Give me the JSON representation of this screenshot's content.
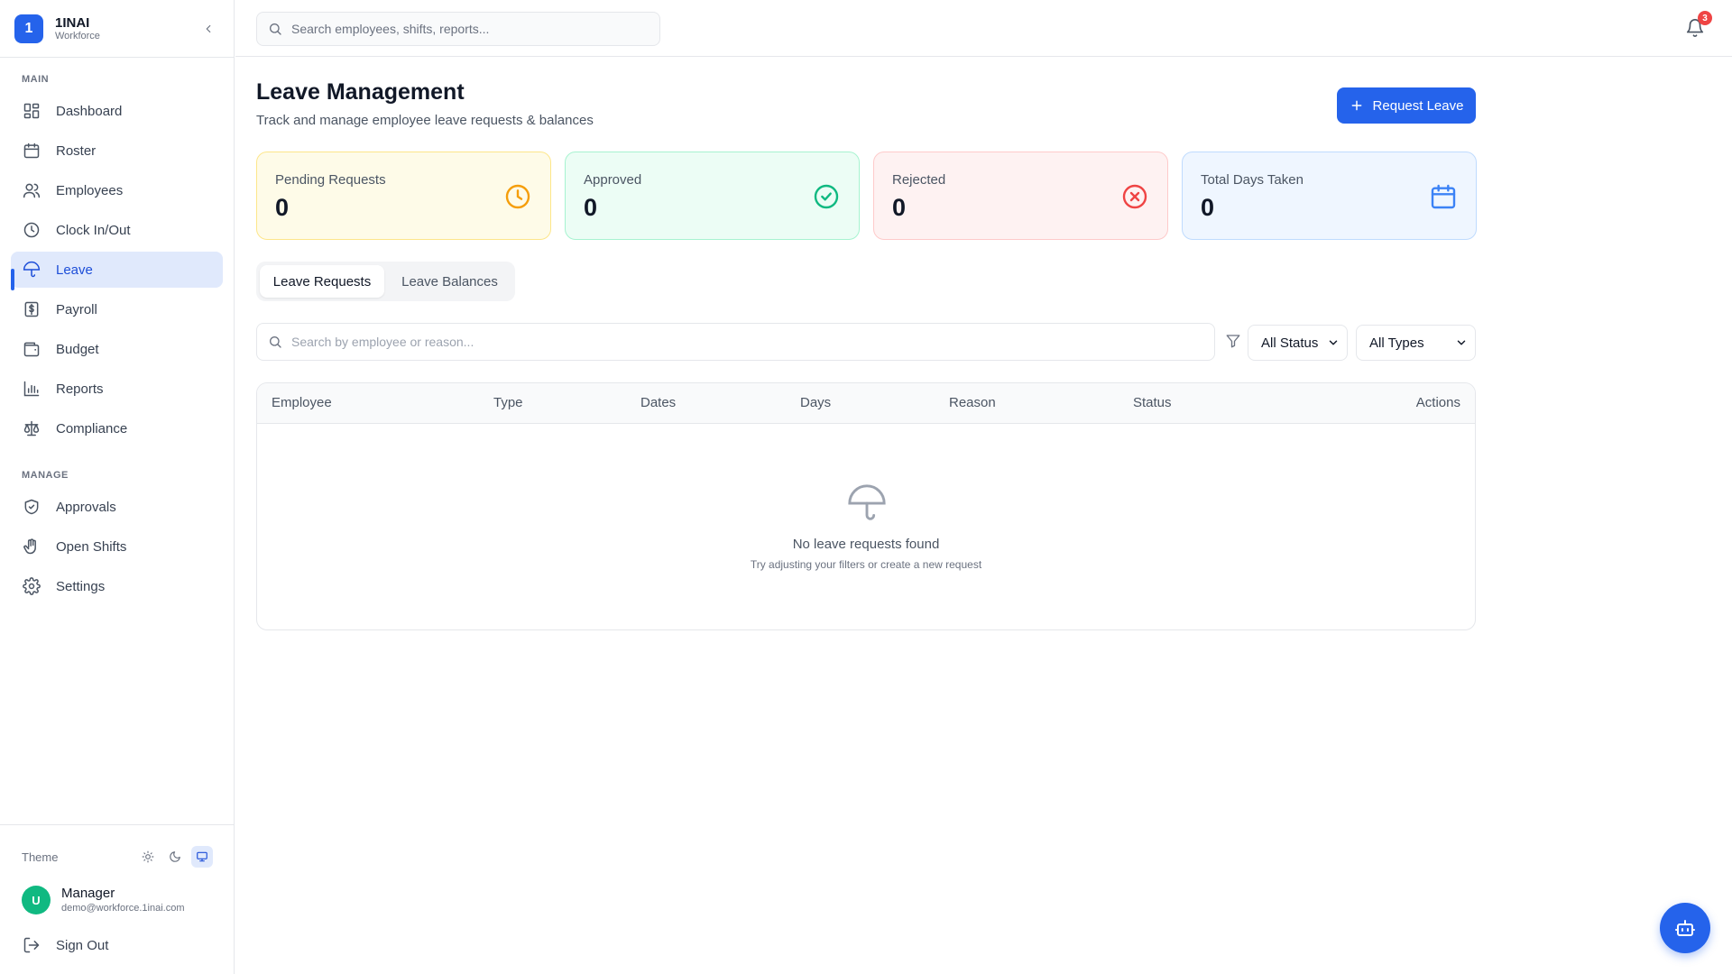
{
  "brand": {
    "logo_letter": "1",
    "name": "1INAI",
    "subtitle": "Workforce"
  },
  "sidebar": {
    "main_label": "MAIN",
    "manage_label": "MANAGE",
    "main_items": [
      {
        "label": "Dashboard",
        "icon": "dashboard-icon"
      },
      {
        "label": "Roster",
        "icon": "calendar-icon"
      },
      {
        "label": "Employees",
        "icon": "users-icon"
      },
      {
        "label": "Clock In/Out",
        "icon": "clock-icon"
      },
      {
        "label": "Leave",
        "icon": "umbrella-icon",
        "active": true
      },
      {
        "label": "Payroll",
        "icon": "dollar-receipt-icon"
      },
      {
        "label": "Budget",
        "icon": "wallet-icon"
      },
      {
        "label": "Reports",
        "icon": "bar-chart-icon"
      },
      {
        "label": "Compliance",
        "icon": "scale-icon"
      }
    ],
    "manage_items": [
      {
        "label": "Approvals",
        "icon": "shield-check-icon"
      },
      {
        "label": "Open Shifts",
        "icon": "hand-icon"
      },
      {
        "label": "Settings",
        "icon": "gear-icon"
      }
    ],
    "theme_label": "Theme",
    "theme_selected": "system",
    "user": {
      "initial": "U",
      "name": "Manager",
      "email": "demo@workforce.1inai.com"
    },
    "sign_out_label": "Sign Out"
  },
  "topbar": {
    "search_placeholder": "Search employees, shifts, reports...",
    "notification_count": "3"
  },
  "page": {
    "title": "Leave Management",
    "subtitle": "Track and manage employee leave requests & balances",
    "request_button": "Request Leave"
  },
  "stats": {
    "pending": {
      "label": "Pending Requests",
      "value": "0",
      "color": "#f59e0b"
    },
    "approved": {
      "label": "Approved",
      "value": "0",
      "color": "#10b981"
    },
    "rejected": {
      "label": "Rejected",
      "value": "0",
      "color": "#ef4444"
    },
    "total": {
      "label": "Total Days Taken",
      "value": "0",
      "color": "#3b82f6"
    }
  },
  "tabs": {
    "requests": "Leave Requests",
    "balances": "Leave Balances",
    "active": "requests"
  },
  "filters": {
    "search_placeholder": "Search by employee or reason...",
    "status_selected": "All Status",
    "type_selected": "All Types"
  },
  "table": {
    "columns": [
      "Employee",
      "Type",
      "Dates",
      "Days",
      "Reason",
      "Status",
      "Actions"
    ],
    "rows": [],
    "empty_title": "No leave requests found",
    "empty_subtitle": "Try adjusting your filters or create a new request"
  },
  "colors": {
    "accent": "#2563eb",
    "active_nav_bg": "#e0e9fc"
  }
}
